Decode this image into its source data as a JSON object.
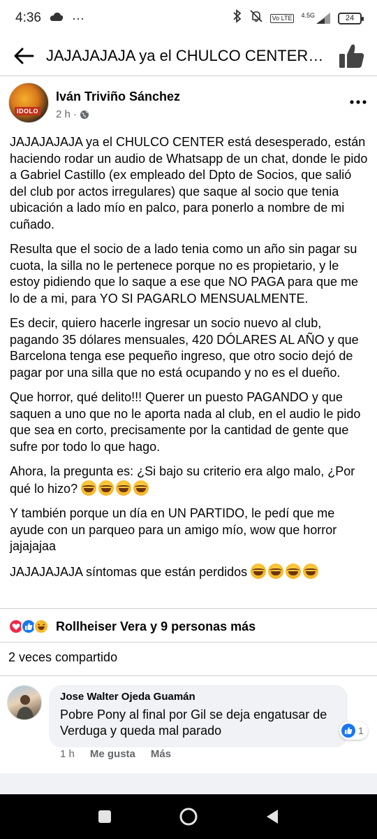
{
  "status_bar": {
    "time": "4:36",
    "overflow": "···",
    "network_badge": "Vo LTE",
    "network_type": "4.5G",
    "battery": "24",
    "icons": [
      "cloud-icon",
      "bluetooth-icon",
      "mute-icon",
      "signal-icon",
      "battery-icon"
    ]
  },
  "header": {
    "title": "JAJAJAJAJA ya el CHULCO CENTER está desesperado…"
  },
  "post": {
    "avatar_label": "IDOLO",
    "author": "Iván Triviño Sánchez",
    "time": "2 h",
    "time_separator": "·",
    "paragraphs": [
      "JAJAJAJAJA ya el CHULCO CENTER está desesperado, están haciendo rodar un audio de Whatsapp de un chat, donde le pido a Gabriel Castillo (ex empleado del Dpto de Socios, que salió del club por actos irregulares) que saque al socio que tenia ubicación a lado mío en palco, para ponerlo a nombre de mi cuñado.",
      "Resulta que el socio de a lado tenia como un año sin pagar su cuota, la silla no le pertenece porque no es propietario, y le estoy pidiendo que lo saque a ese que NO PAGA para que me lo de a mi, para YO SI PAGARLO MENSUALMENTE.",
      "Es decir, quiero hacerle ingresar un socio nuevo al club, pagando 35 dólares mensuales, 420 DÓLARES AL AÑO y que Barcelona tenga ese pequeño ingreso, que otro socio dejó de pagar por una silla que no está ocupando y no es el dueño.",
      "Que horror, qué delito!!! Querer un puesto PAGANDO y que saquen a uno que no le aporta nada al club, en el audio le pido que sea en corto, precisamente por la cantidad de gente que sufre por todo lo que hago.",
      "Ahora, la pregunta es: ¿Si bajo su criterio era algo malo, ¿Por qué lo hizo?",
      "Y también porque un día en UN PARTIDO, le pedí que me ayude con un parqueo para un amigo mío, wow que horror jajajajaa",
      "JAJAJAJAJA síntomas que están perdidos"
    ]
  },
  "reactions": {
    "text": "Rollheiser Vera y 9 personas más"
  },
  "shares": "2 veces compartido",
  "comment": {
    "author": "Jose Walter Ojeda Guamán",
    "text": "Pobre Pony al final por Gil se deja engatusar de Verduga y queda mal parado",
    "like_count": "1",
    "time": "1 h",
    "like_label": "Me gusta",
    "more_label": "Más"
  },
  "colors": {
    "facebook_blue": "#1877f2",
    "love_red": "#f0284a",
    "haha_yellow": "#f7b928",
    "secondary_text": "#65676b",
    "bubble_bg": "#f0f2f5"
  }
}
